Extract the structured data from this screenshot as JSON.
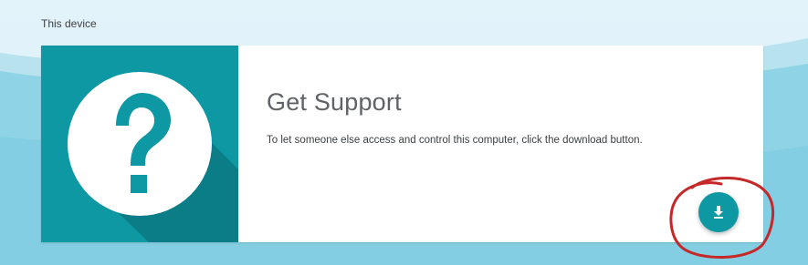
{
  "section": {
    "label": "This device"
  },
  "card": {
    "title": "Get Support",
    "description": "To let someone else access and control this computer, click the download button.",
    "hero_icon": "question-mark-icon"
  },
  "download_button": {
    "icon": "download-icon"
  },
  "colors": {
    "accent": "#0e98a3",
    "accent_dark": "#0a7d86",
    "background_sky": "#dff1f8",
    "background_wave": "#8fd3e6",
    "annotation": "#c62828"
  }
}
